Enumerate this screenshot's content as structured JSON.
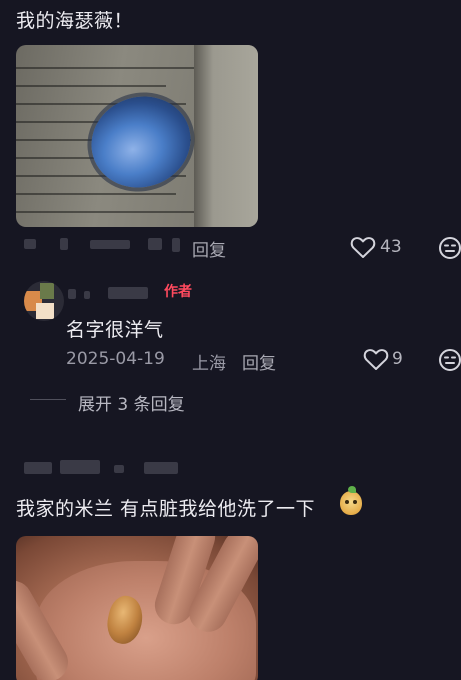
{
  "comment1": {
    "text": "我的海瑟薇！",
    "reply_label": "回复",
    "like_count": "43"
  },
  "reply1": {
    "author_tag": "作者",
    "text": "名字很洋气",
    "date": "2025-04-19",
    "location": "上海",
    "reply_label": "回复",
    "like_count": "9"
  },
  "expand": {
    "label": "展开 3 条回复"
  },
  "comment2": {
    "text": "我家的米兰 有点脏我给他洗了一下"
  },
  "colors": {
    "background": "#161622",
    "author_tag": "#ff4a5e"
  },
  "icons": {
    "like": "heart-outline-icon",
    "dislike": "meh-face-icon"
  }
}
